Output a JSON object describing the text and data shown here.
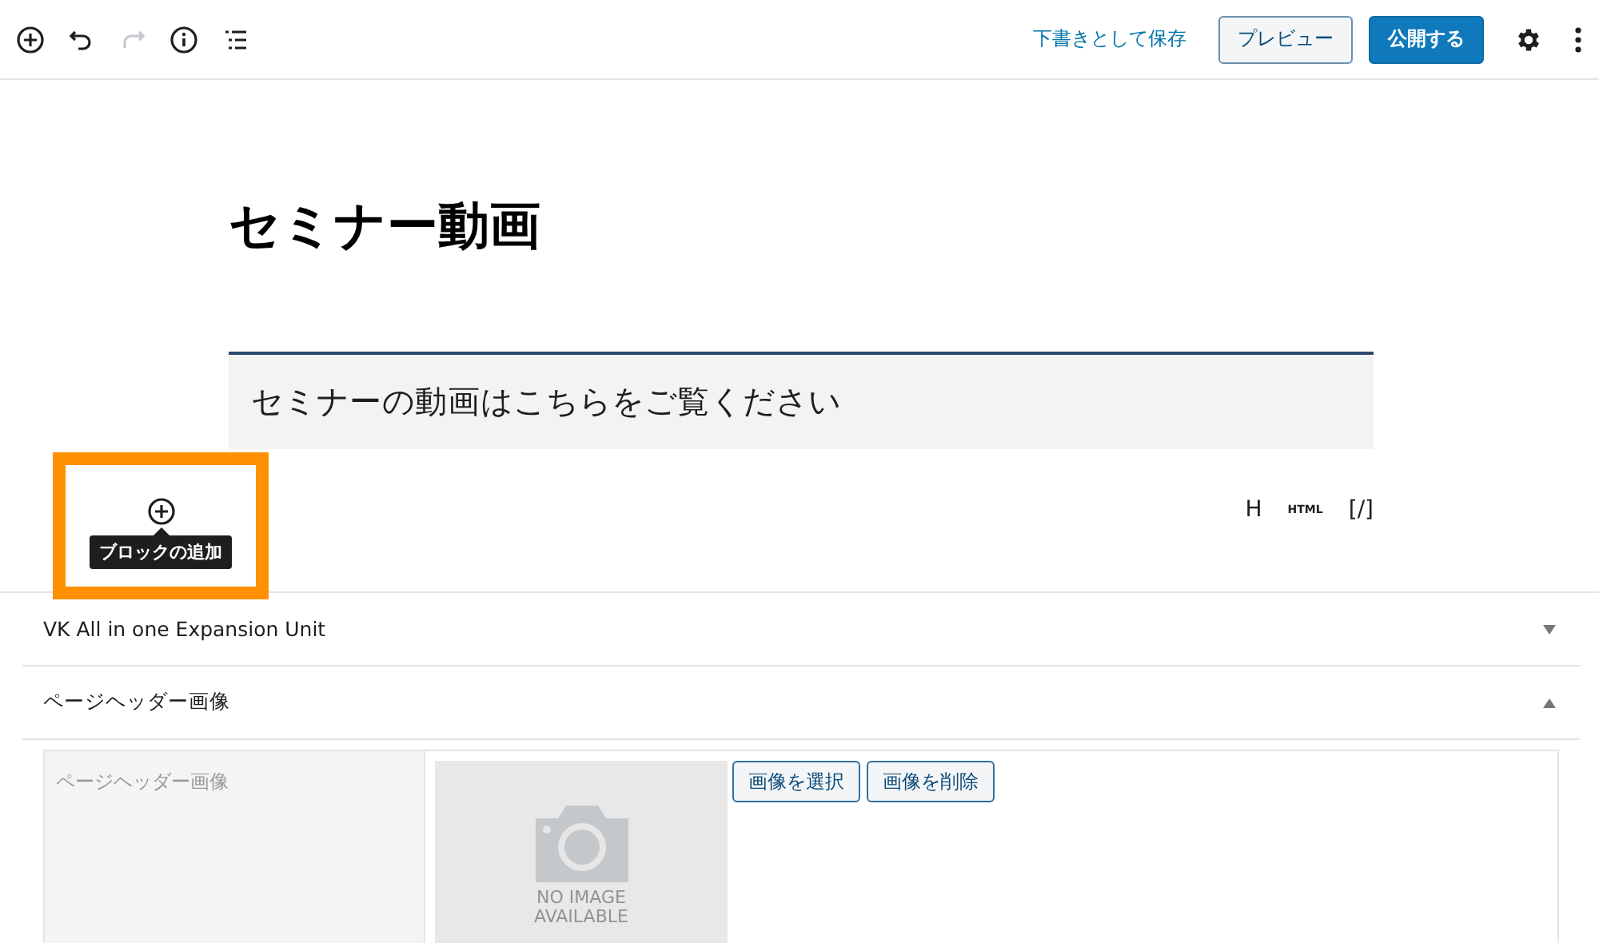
{
  "toolbar": {
    "tools": [
      {
        "kind": "add",
        "disabled": false
      },
      {
        "kind": "undo",
        "disabled": false
      },
      {
        "kind": "redo",
        "disabled": true
      },
      {
        "kind": "info",
        "disabled": false
      },
      {
        "kind": "outline",
        "disabled": false
      }
    ],
    "save_draft": "下書きとして保存",
    "preview": "プレビュー",
    "publish": "公開する"
  },
  "post": {
    "title": "セミナー動画",
    "heading": "セミナーの動画はこちらをご覧ください"
  },
  "inserter": {
    "tooltip": "ブロックの追加"
  },
  "format_tools": [
    "H",
    "HTML",
    "[/]"
  ],
  "panels": [
    {
      "title": "VK All in one Expansion Unit",
      "expanded": false
    },
    {
      "title": "ページヘッダー画像",
      "expanded": true
    }
  ],
  "header_image": {
    "label": "ページヘッダー画像",
    "placeholder_text": [
      "NO IMAGE",
      "AVAILABLE"
    ],
    "buttons": [
      "画像を選択",
      "画像を削除"
    ]
  }
}
